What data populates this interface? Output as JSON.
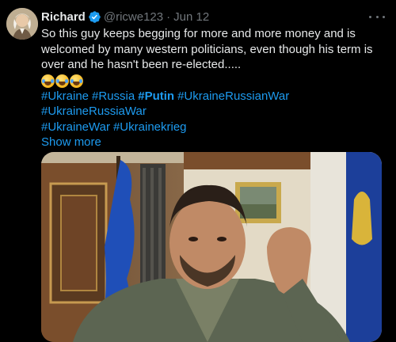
{
  "author": {
    "name": "Richard",
    "handle": "@ricwe123",
    "separator": "·",
    "date": "Jun 12",
    "verified_icon": "verified-badge-icon"
  },
  "tweet": {
    "text": "So this guy keeps begging for more and more money and is welcomed by many western politicians, even though his term is over and he hasn't been re-elected.....",
    "emojis": [
      "😂",
      "😂",
      "😂"
    ],
    "hashtags_line1": [
      "#Ukraine",
      "#Russia",
      "#Putin",
      "#UkraineRussianWar"
    ],
    "hashtags_line2": [
      "#UkraineRussiaWar"
    ],
    "hashtags_line3": [
      "#UkraineWar",
      "#Ukrainekrieg"
    ],
    "show_more": "Show more"
  },
  "colors": {
    "background": "#000000",
    "text": "#e7e9ea",
    "secondary": "#71767b",
    "link": "#1d9bf0"
  }
}
